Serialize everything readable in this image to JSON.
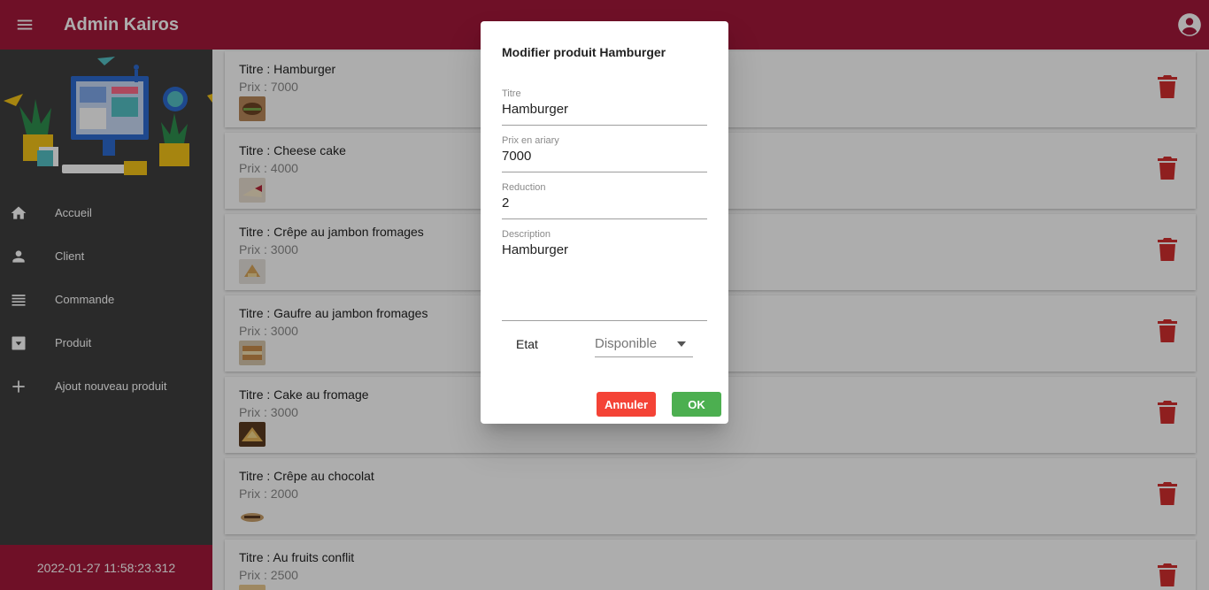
{
  "app": {
    "title": "Admin Kairos"
  },
  "sidebar": {
    "items": [
      {
        "label": "Accueil",
        "icon": "home-icon"
      },
      {
        "label": "Client",
        "icon": "person-icon"
      },
      {
        "label": "Commande",
        "icon": "list-icon"
      },
      {
        "label": "Produit",
        "icon": "archive-icon"
      },
      {
        "label": "Ajout nouveau produit",
        "icon": "plus-icon"
      }
    ],
    "footer_datetime": "2022-01-27 11:58:23.312"
  },
  "products": [
    {
      "title": "Titre : Hamburger",
      "price": "Prix : 7000"
    },
    {
      "title": "Titre : Cheese cake",
      "price": "Prix : 4000"
    },
    {
      "title": "Titre : Crêpe au jambon fromages",
      "price": "Prix : 3000"
    },
    {
      "title": "Titre : Gaufre au jambon fromages",
      "price": "Prix : 3000"
    },
    {
      "title": "Titre : Cake au fromage",
      "price": "Prix : 3000"
    },
    {
      "title": "Titre : Crêpe au chocolat",
      "price": "Prix : 2000"
    },
    {
      "title": "Titre : Au fruits conflit",
      "price": "Prix : 2500"
    }
  ],
  "dialog": {
    "title": "Modifier produit Hamburger",
    "titre_label": "Titre",
    "titre_value": "Hamburger",
    "prix_label": "Prix en ariary",
    "prix_value": "7000",
    "reduction_label": "Reduction",
    "reduction_value": "2",
    "description_label": "Description",
    "description_value": "Hamburger",
    "etat_label": "Etat",
    "etat_value": "Disponible",
    "cancel_label": "Annuler",
    "ok_label": "OK"
  },
  "colors": {
    "primary": "#a4193a",
    "sidebar": "#3f3f3f",
    "delete": "#d32f2f",
    "cancel": "#f44336",
    "ok": "#4caf50"
  }
}
